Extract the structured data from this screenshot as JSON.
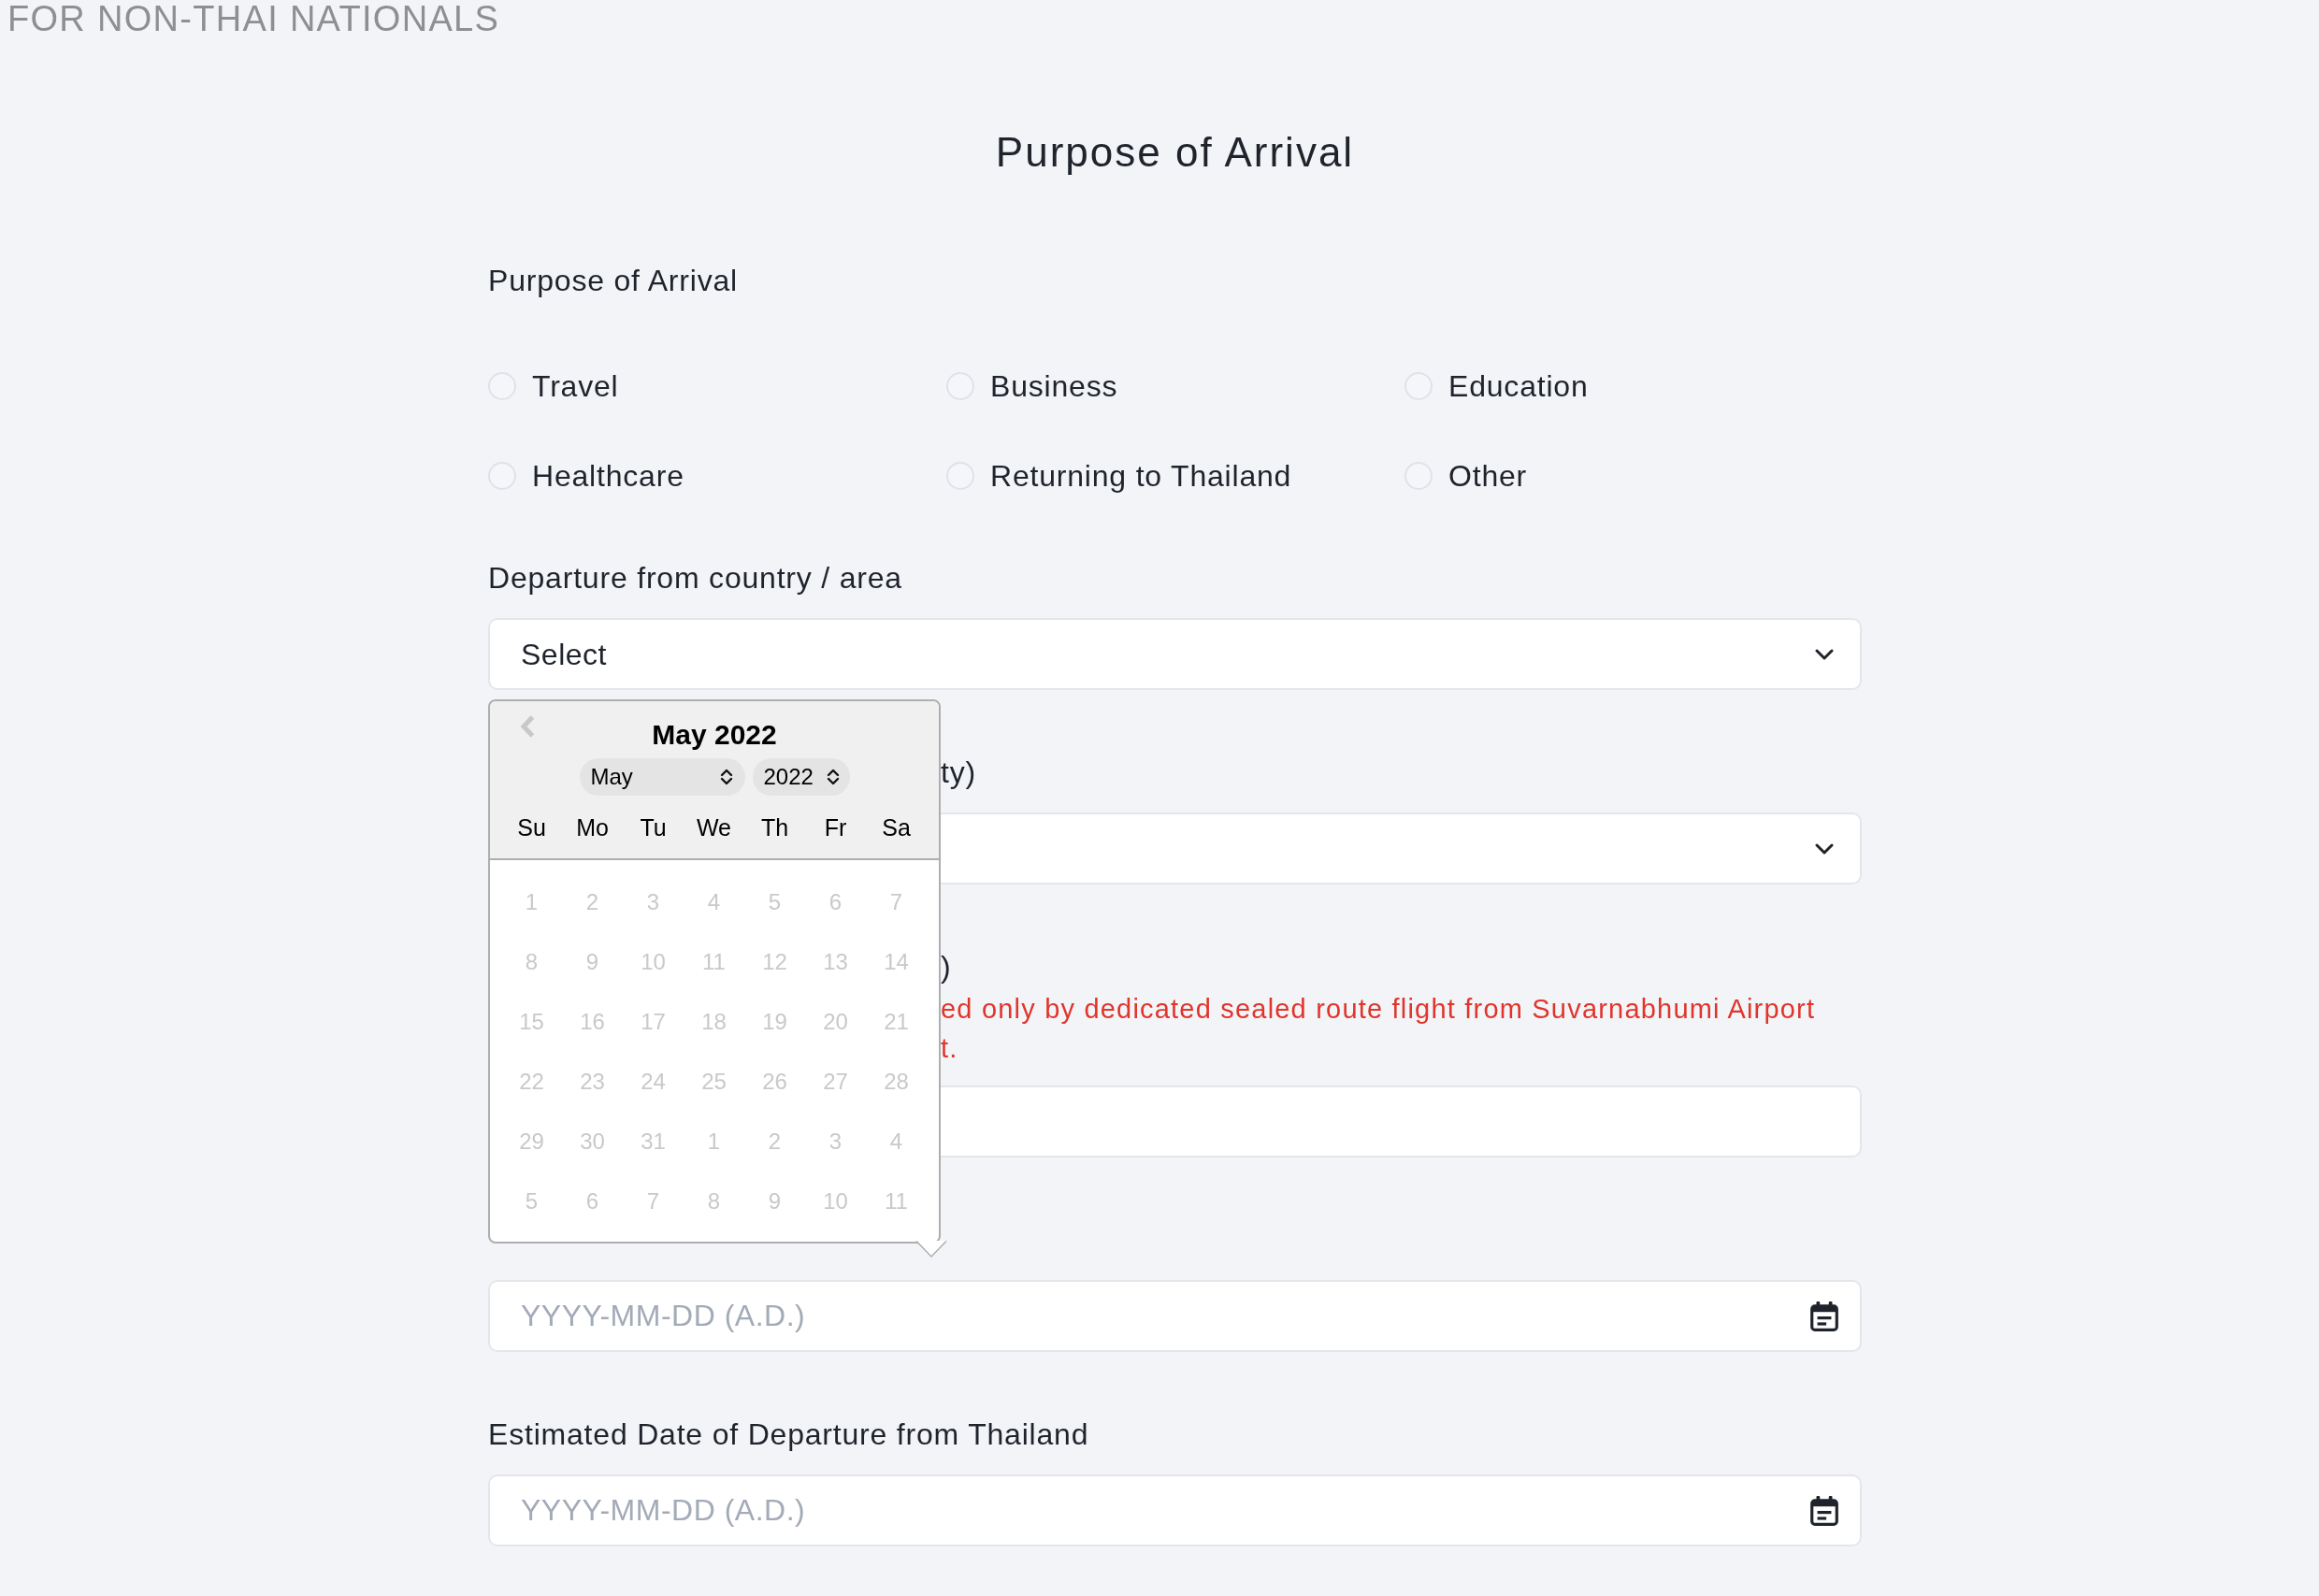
{
  "page_header": "FOR NON-THAI NATIONALS",
  "title": "Purpose of Arrival",
  "purpose": {
    "label": "Purpose of Arrival",
    "options": [
      {
        "label": "Travel",
        "selected": false
      },
      {
        "label": "Business",
        "selected": false
      },
      {
        "label": "Education",
        "selected": false
      },
      {
        "label": "Healthcare",
        "selected": false
      },
      {
        "label": "Returning to Thailand",
        "selected": false
      },
      {
        "label": "Other",
        "selected": false
      }
    ]
  },
  "fields": [
    {
      "kind": "select",
      "label": "Departure from country / area",
      "value": "Select",
      "covered": false
    },
    {
      "kind": "select",
      "label": "ty)",
      "covered": true
    },
    {
      "kind": "text",
      "label": ")",
      "note_lines": [
        "ed only by dedicated sealed route flight from Suvarnabhumi Airport",
        "t."
      ],
      "covered": true
    },
    {
      "kind": "date",
      "placeholder": "YYYY-MM-DD (A.D.)",
      "covered": false
    },
    {
      "kind": "date",
      "label": "Estimated Date of Departure from Thailand",
      "placeholder": "YYYY-MM-DD (A.D.)",
      "covered": false
    }
  ],
  "date_picker": {
    "title": "May 2022",
    "prev_disabled": true,
    "month": "May",
    "year": "2022",
    "weekdays": [
      "Su",
      "Mo",
      "Tu",
      "We",
      "Th",
      "Fr",
      "Sa"
    ],
    "weeks": [
      [
        {
          "day": "1",
          "disabled": true
        },
        {
          "day": "2",
          "disabled": true
        },
        {
          "day": "3",
          "disabled": true
        },
        {
          "day": "4",
          "disabled": true
        },
        {
          "day": "5",
          "disabled": true
        },
        {
          "day": "6",
          "disabled": true
        },
        {
          "day": "7",
          "disabled": true
        }
      ],
      [
        {
          "day": "8",
          "disabled": true
        },
        {
          "day": "9",
          "disabled": true
        },
        {
          "day": "10",
          "disabled": true
        },
        {
          "day": "11",
          "disabled": true
        },
        {
          "day": "12",
          "disabled": true
        },
        {
          "day": "13",
          "disabled": true
        },
        {
          "day": "14",
          "disabled": true
        }
      ],
      [
        {
          "day": "15",
          "disabled": true
        },
        {
          "day": "16",
          "disabled": true
        },
        {
          "day": "17",
          "disabled": true
        },
        {
          "day": "18",
          "disabled": true
        },
        {
          "day": "19",
          "disabled": true
        },
        {
          "day": "20",
          "disabled": true
        },
        {
          "day": "21",
          "disabled": true
        }
      ],
      [
        {
          "day": "22",
          "disabled": true
        },
        {
          "day": "23",
          "disabled": true
        },
        {
          "day": "24",
          "disabled": true
        },
        {
          "day": "25",
          "disabled": true
        },
        {
          "day": "26",
          "disabled": true
        },
        {
          "day": "27",
          "disabled": true
        },
        {
          "day": "28",
          "disabled": true
        }
      ],
      [
        {
          "day": "29",
          "disabled": true
        },
        {
          "day": "30",
          "disabled": true
        },
        {
          "day": "31",
          "disabled": true
        },
        {
          "day": "1",
          "disabled": true
        },
        {
          "day": "2",
          "disabled": true
        },
        {
          "day": "3",
          "disabled": true
        },
        {
          "day": "4",
          "disabled": true
        }
      ],
      [
        {
          "day": "5",
          "disabled": true
        },
        {
          "day": "6",
          "disabled": true
        },
        {
          "day": "7",
          "disabled": true
        },
        {
          "day": "8",
          "disabled": true
        },
        {
          "day": "9",
          "disabled": true
        },
        {
          "day": "10",
          "disabled": true
        },
        {
          "day": "11",
          "disabled": true
        }
      ]
    ]
  }
}
